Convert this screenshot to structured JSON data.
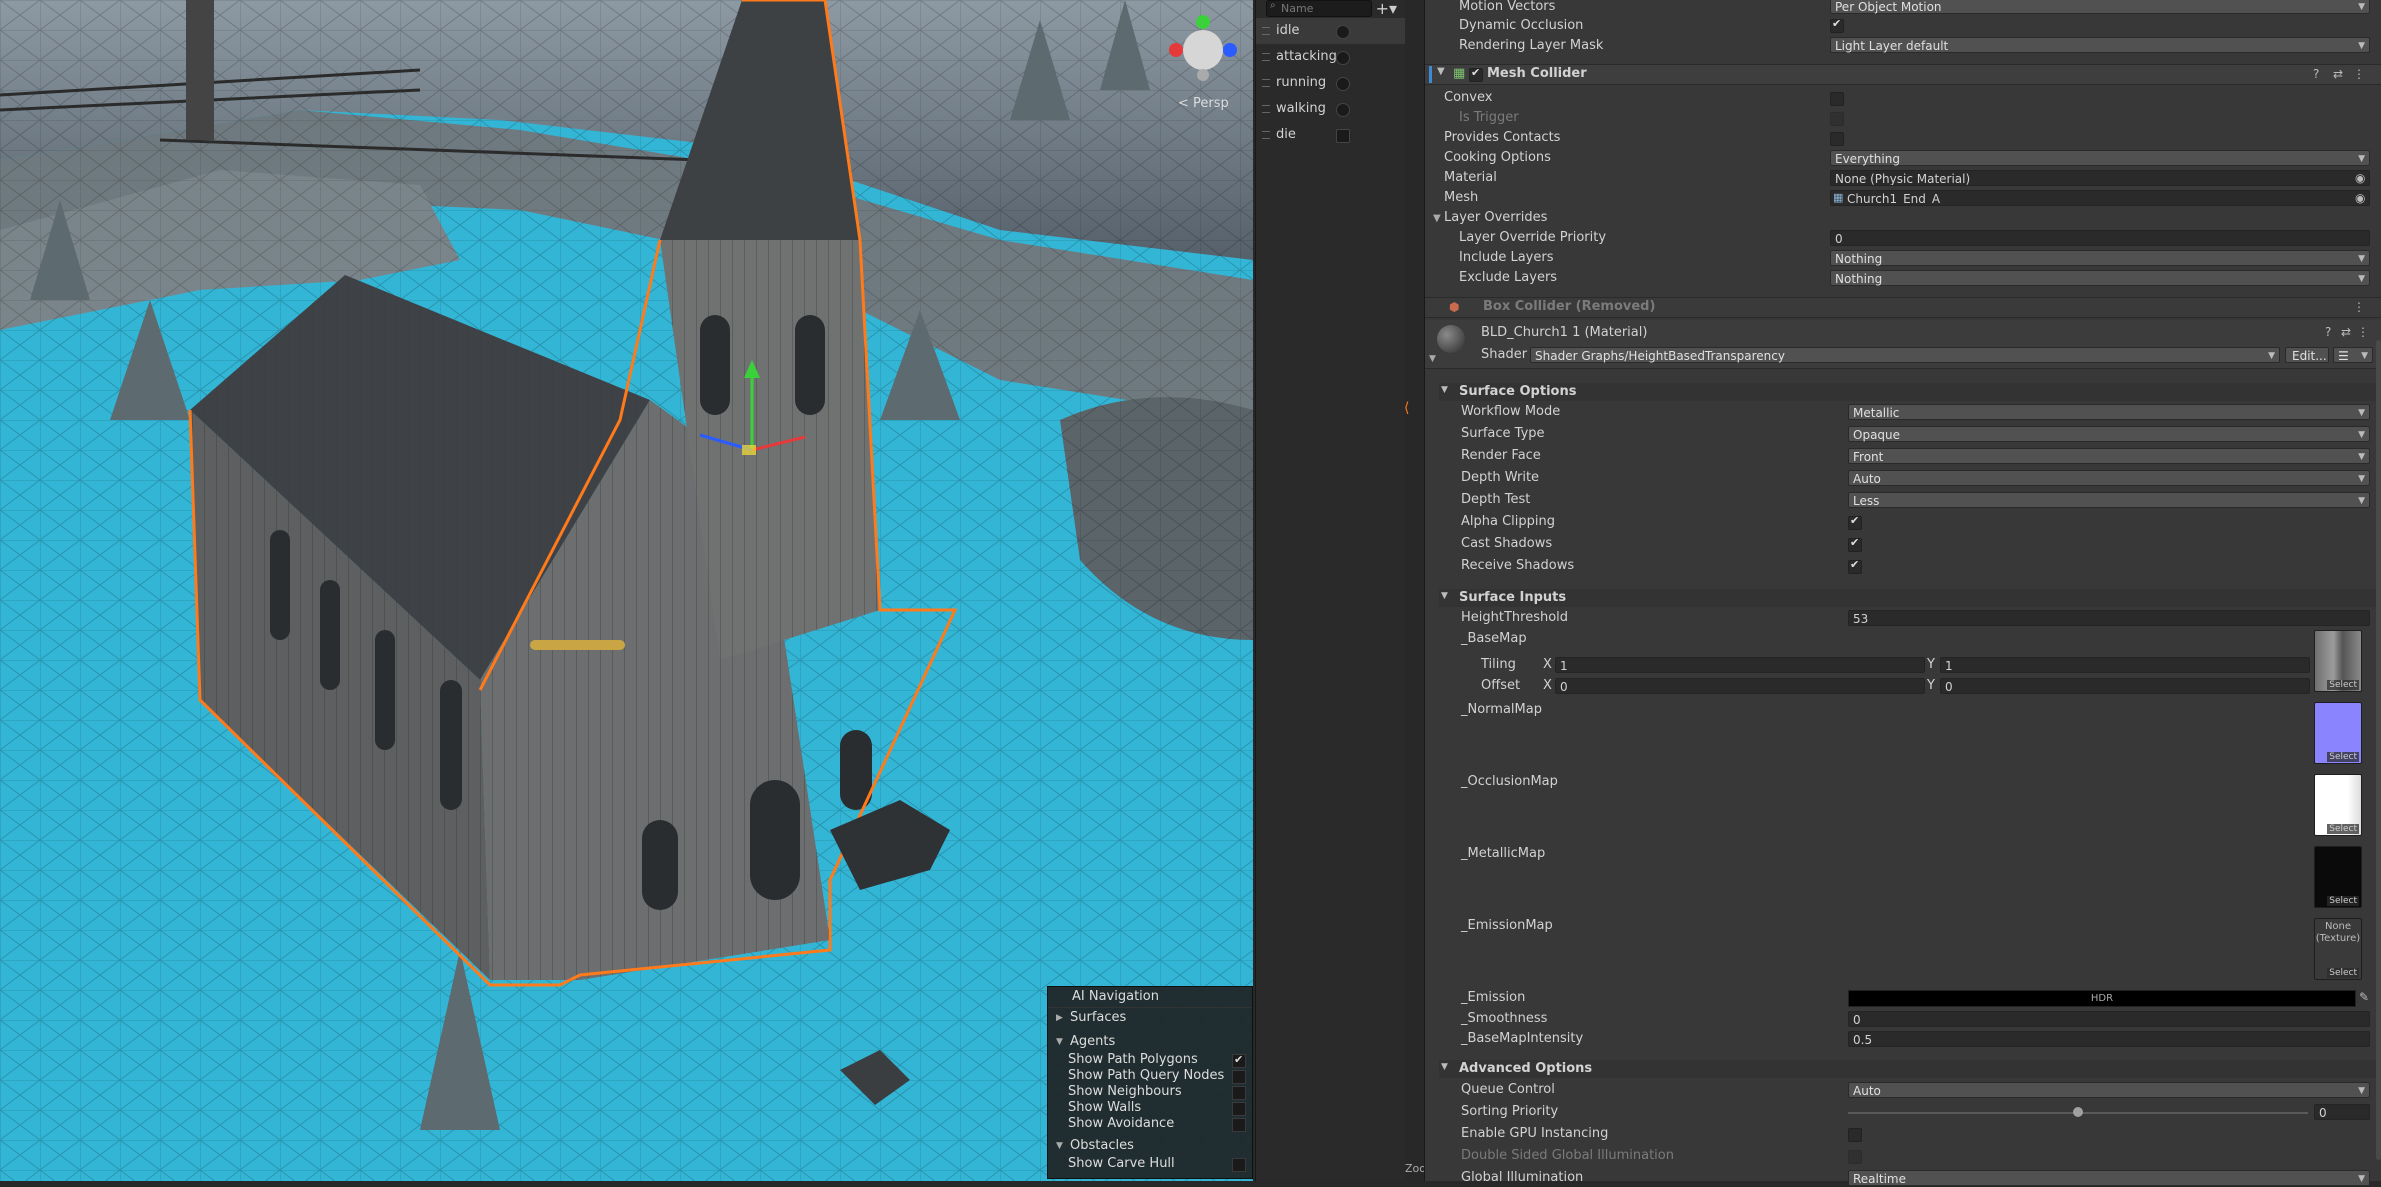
{
  "scene": {
    "ai_navigation": {
      "title": "AI Navigation",
      "surfaces": "Surfaces",
      "agents": "Agents",
      "agent_items": [
        {
          "label": "Show Path Polygons",
          "checked": true
        },
        {
          "label": "Show Path Query Nodes",
          "checked": false
        },
        {
          "label": "Show Neighbours",
          "checked": false
        },
        {
          "label": "Show Walls",
          "checked": false
        },
        {
          "label": "Show Avoidance",
          "checked": false
        }
      ],
      "obstacles": "Obstacles",
      "obstacle_items": [
        {
          "label": "Show Carve Hull",
          "checked": false
        }
      ]
    },
    "gizmo_label": "< Persp"
  },
  "animator_params": {
    "search_placeholder": "Name",
    "add_icon": "plus-dropdown-icon",
    "params": [
      {
        "name": "idle",
        "kind": "bool"
      },
      {
        "name": "attacking",
        "kind": "bool"
      },
      {
        "name": "running",
        "kind": "bool"
      },
      {
        "name": "walking",
        "kind": "bool"
      },
      {
        "name": "die",
        "kind": "trigger"
      }
    ],
    "zoom_label": "Zoo"
  },
  "inspector": {
    "renderer": {
      "motion_vectors_label": "Motion Vectors",
      "motion_vectors_value": "Per Object Motion",
      "dynamic_occlusion_label": "Dynamic Occlusion",
      "dynamic_occlusion": true,
      "rendering_layer_mask_label": "Rendering Layer Mask",
      "rendering_layer_mask_value": "Light Layer default"
    },
    "mesh_collider": {
      "title": "Mesh Collider",
      "convex": "Convex",
      "is_trigger": "Is Trigger",
      "provides_contacts": "Provides Contacts",
      "cooking_options": "Cooking Options",
      "cooking_value": "Everything",
      "material": "Material",
      "material_value": "None (Physic Material)",
      "mesh": "Mesh",
      "mesh_value": "Church1_End_A",
      "layer_overrides": "Layer Overrides",
      "layer_override_priority": "Layer Override Priority",
      "layer_override_priority_value": "0",
      "include_layers": "Include Layers",
      "include_layers_value": "Nothing",
      "exclude_layers": "Exclude Layers",
      "exclude_layers_value": "Nothing"
    },
    "box_collider": {
      "title": "Box Collider (Removed)"
    },
    "material": {
      "title": "BLD_Church1 1 (Material)",
      "shader_label": "Shader",
      "shader_value": "Shader Graphs/HeightBasedTransparency",
      "edit_button": "Edit..."
    },
    "surface_options": {
      "title": "Surface Options",
      "rows": [
        {
          "label": "Workflow Mode",
          "value": "Metallic"
        },
        {
          "label": "Surface Type",
          "value": "Opaque"
        },
        {
          "label": "Render Face",
          "value": "Front"
        },
        {
          "label": "Depth Write",
          "value": "Auto"
        },
        {
          "label": "Depth Test",
          "value": "Less"
        }
      ],
      "alpha_clipping": "Alpha Clipping",
      "cast_shadows": "Cast Shadows",
      "receive_shadows": "Receive Shadows"
    },
    "surface_inputs": {
      "title": "Surface Inputs",
      "height_threshold_label": "HeightThreshold",
      "height_threshold_value": "53",
      "base_map": "_BaseMap",
      "tiling": "Tiling",
      "offset": "Offset",
      "x_label": "X",
      "y_label": "Y",
      "tiling_x": "1",
      "tiling_y": "1",
      "offset_x": "0",
      "offset_y": "0",
      "normal_map": "_NormalMap",
      "occlusion_map": "_OcclusionMap",
      "metallic_map": "_MetallicMap",
      "emission_map": "_EmissionMap",
      "emission_none": "None (Texture)",
      "select": "Select",
      "emission": "_Emission",
      "hdr": "HDR",
      "smoothness": "_Smoothness",
      "smoothness_value": "0",
      "base_map_intensity": "_BaseMapIntensity",
      "base_map_intensity_value": "0.5"
    },
    "advanced_options": {
      "title": "Advanced Options",
      "queue_control": "Queue Control",
      "queue_control_value": "Auto",
      "sorting_priority": "Sorting Priority",
      "sorting_priority_value": "0",
      "sorting_priority_slider": 0.5,
      "enable_gpu_instancing": "Enable GPU Instancing",
      "double_sided_gi": "Double Sided Global Illumination",
      "global_illumination": "Global Illumination",
      "global_illumination_value": "Realtime"
    }
  },
  "colors": {
    "selection_outline": "#ff7a1a",
    "navmesh": "#33b6d6",
    "inspector_bg": "#383838"
  }
}
